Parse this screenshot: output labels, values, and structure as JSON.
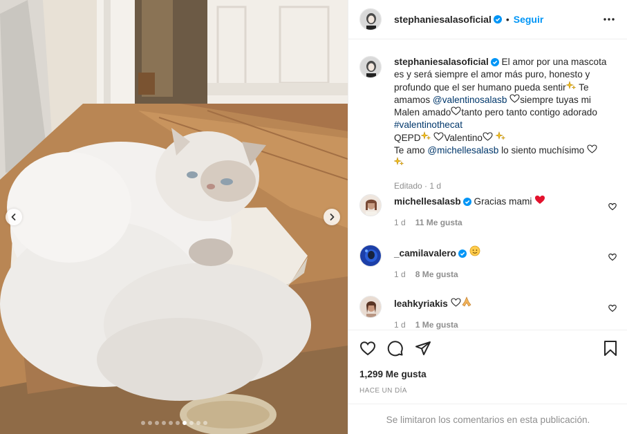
{
  "post": {
    "username": "stephaniesalasoficial",
    "separator": "•",
    "follow_label": "Seguir",
    "caption": {
      "text_1": "El amor por una mascota es y será siempre el amor más puro, honesto y profundo que el ser humano pueda sentir",
      "text_2": "Te amamos",
      "mention_1": "@valentinosalasb",
      "text_3": "siempre tuyas mi Malen amado",
      "text_4": "tanto pero tanto contigo adorado",
      "hashtag": "#valentinothecat",
      "text_5": "QEPD",
      "text_6": "Valentino",
      "text_7": "Te amo",
      "mention_2": "@michellesalasb",
      "text_8": "lo siento muchísimo",
      "meta": "Editado · 1 d"
    },
    "comments": [
      {
        "username": "michellesalasb",
        "verified": true,
        "text": "Gracias mami",
        "emoji": "red-heart",
        "age": "1 d",
        "likes": "11 Me gusta"
      },
      {
        "username": "_camilavalero",
        "verified": true,
        "text": "",
        "emoji": "smiling-face",
        "age": "1 d",
        "likes": "8 Me gusta"
      },
      {
        "username": "leahkyriakis",
        "verified": false,
        "text": "",
        "emoji": "heart-praying-hands",
        "age": "1 d",
        "likes": "1 Me gusta"
      }
    ],
    "likes": "1,299 Me gusta",
    "timestamp": "HACE UN DÍA",
    "comments_disabled": "Se limitaron los comentarios en esta publicación.",
    "carousel": {
      "slide_count": 10,
      "active_index": 6
    }
  },
  "colors": {
    "accent": "#0095f6",
    "verified": "#0095f6",
    "text": "#262626",
    "muted": "#8e8e8e",
    "heart": "#ed4956"
  },
  "icons": [
    "more-options-icon",
    "heart-icon",
    "comment-icon",
    "share-icon",
    "save-icon",
    "chevron-left-icon",
    "chevron-right-icon",
    "verified-badge-icon",
    "sparkles-icon"
  ]
}
